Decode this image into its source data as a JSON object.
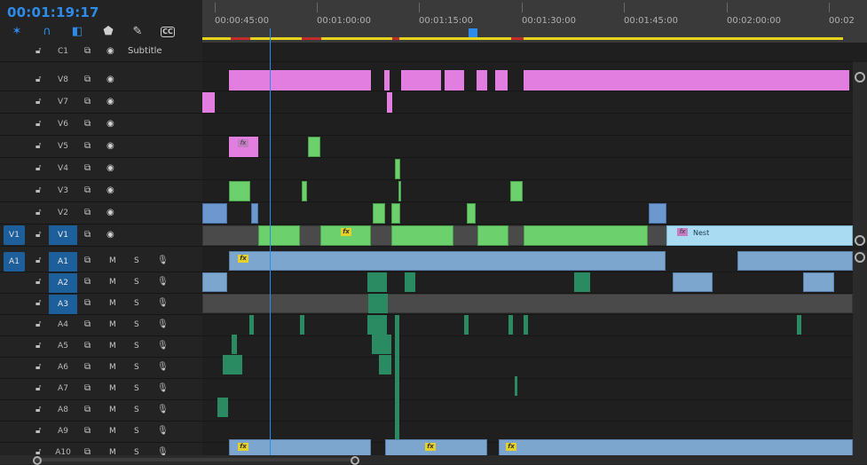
{
  "timecode": "00:01:19:17",
  "toolbar": {
    "snap": "snap-icon",
    "linked": "linked-selection-icon",
    "add_marker": "marker-icon",
    "settings": "wrench-icon",
    "captions": "CC"
  },
  "ruler": {
    "ticks": [
      "00:00:45:00",
      "00:01:00:00",
      "00:01:15:00",
      "00:01:30:00",
      "00:01:45:00",
      "00:02:00:00",
      "00:02"
    ]
  },
  "subtitle_track": {
    "name": "C1",
    "label": "Subtitle"
  },
  "video_tracks": [
    {
      "name": "V8"
    },
    {
      "name": "V7"
    },
    {
      "name": "V6"
    },
    {
      "name": "V5"
    },
    {
      "name": "V4"
    },
    {
      "name": "V3"
    },
    {
      "name": "V2"
    },
    {
      "name": "V1",
      "target": "V1"
    }
  ],
  "audio_tracks": [
    {
      "name": "A1",
      "target": "A1"
    },
    {
      "name": "A2"
    },
    {
      "name": "A3"
    },
    {
      "name": "A4"
    },
    {
      "name": "A5"
    },
    {
      "name": "A6"
    },
    {
      "name": "A7"
    },
    {
      "name": "A8"
    },
    {
      "name": "A9"
    },
    {
      "name": "A10"
    }
  ],
  "audio_buttons": {
    "mute": "M",
    "solo": "S"
  },
  "clip_labels": {
    "fx": "fx",
    "nest": "Nest"
  },
  "colors": {
    "accent": "#2d8ceb",
    "work_area": "#e5d31c",
    "graphics_clip": "#e27ee0",
    "video_clip": "#6cd06c",
    "nest_clip": "#a9dbf3",
    "audio_clip": "#7da6cf"
  }
}
